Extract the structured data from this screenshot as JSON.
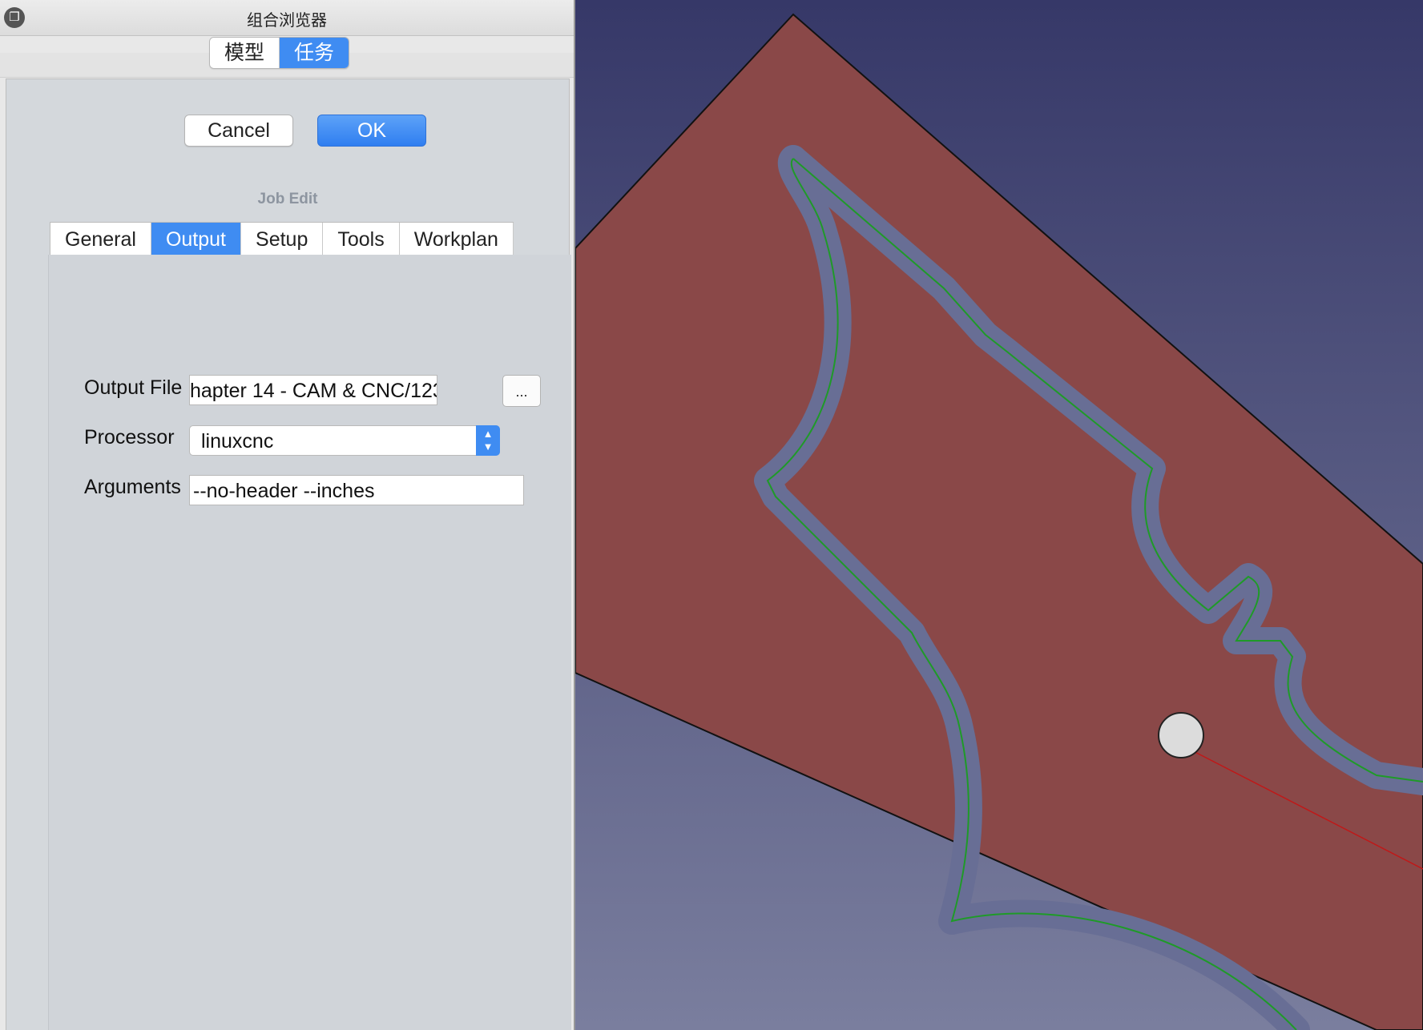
{
  "panel": {
    "title": "组合浏览器",
    "tabs": [
      {
        "label": "模型",
        "active": false
      },
      {
        "label": "任务",
        "active": true
      }
    ]
  },
  "task": {
    "cancel_label": "Cancel",
    "ok_label": "OK",
    "title": "Job Edit",
    "tabs": [
      {
        "label": "General",
        "active": false
      },
      {
        "label": "Output",
        "active": true
      },
      {
        "label": "Setup",
        "active": false
      },
      {
        "label": "Tools",
        "active": false
      },
      {
        "label": "Workplan",
        "active": false
      }
    ],
    "output": {
      "output_file_label": "Output File",
      "output_file_value": "hapter 14 - CAM & CNC/123",
      "browse_label": "...",
      "processor_label": "Processor",
      "processor_value": "linuxcnc",
      "arguments_label": "Arguments",
      "arguments_value": "--no-header --inches"
    }
  },
  "view3d": {
    "background_top": "#363868",
    "background_bottom": "#7a7e9e",
    "stock_color": "#8a4848",
    "pocket_color": "#686e95",
    "toolpath_color": "#1f9a28",
    "axis_color": "#c01818"
  }
}
